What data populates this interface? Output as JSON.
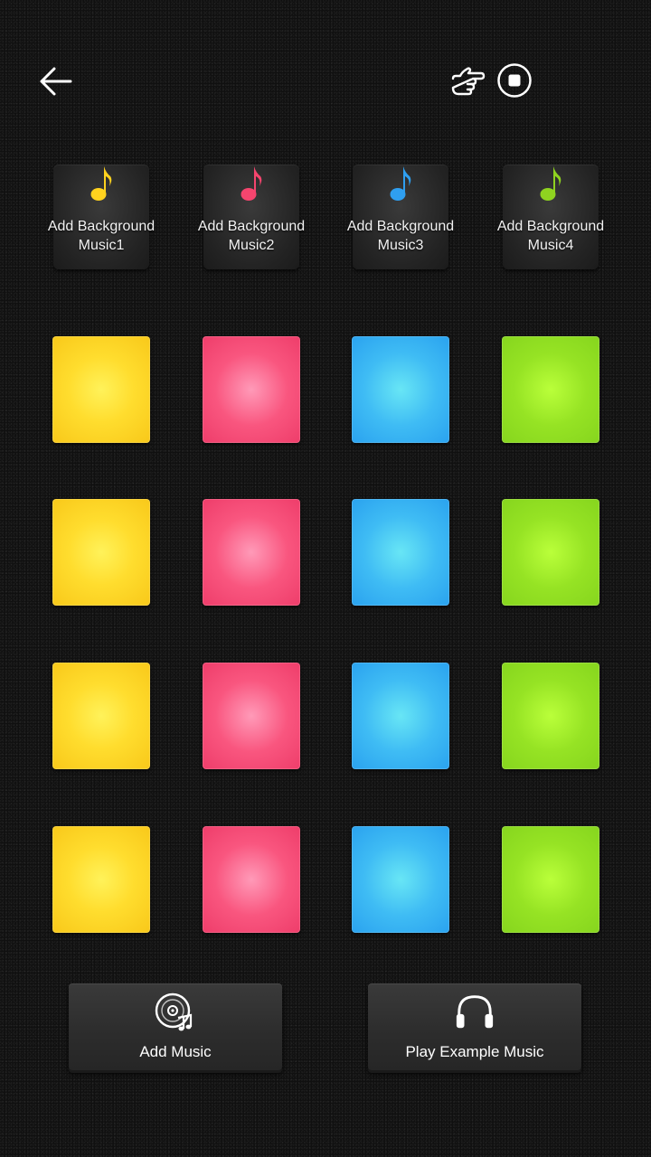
{
  "toolbar": {
    "back_icon": "arrow-left-icon",
    "gesture_icon": "pointing-hand-icon",
    "stop_icon": "stop-icon"
  },
  "background_music": [
    {
      "line1": "Add Background",
      "line2": "Music1",
      "note_color": "#ffd21e"
    },
    {
      "line1": "Add Background",
      "line2": "Music2",
      "note_color": "#f5456e"
    },
    {
      "line1": "Add Background",
      "line2": "Music3",
      "note_color": "#2f9ff0"
    },
    {
      "line1": "Add Background",
      "line2": "Music4",
      "note_color": "#8fd320"
    }
  ],
  "pad_colors": {
    "yellow": "#ffdd2e",
    "pink": "#f9567f",
    "blue": "#3fbcf4",
    "green": "#96e324"
  },
  "bottom": {
    "add_music_label": "Add Music",
    "add_music_icon": "disc-music-icon",
    "play_example_label": "Play Example Music",
    "play_example_icon": "headphones-icon"
  }
}
